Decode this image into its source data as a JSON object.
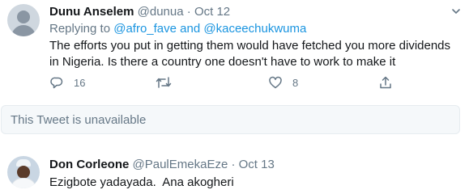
{
  "tweet1": {
    "name": "Dunu Anselem",
    "handle": "@dunua",
    "separator": "·",
    "date": "Oct 12",
    "replying_prefix": "Replying to",
    "reply_handle_1": "@afro_fave",
    "reply_and": "and",
    "reply_handle_2": "@kaceechukwuma",
    "text": "The efforts you put in getting them would have fetched you more dividends in Nigeria. Is there a country one doesn't have to work to make it",
    "reply_count": "16",
    "like_count": "8"
  },
  "unavailable": {
    "text": "This Tweet is unavailable"
  },
  "tweet2": {
    "name": "Don Corleone",
    "handle": "@PaulEmekaEze",
    "separator": "·",
    "date": "Oct 13",
    "text": "Ezigbote yadayada.  Ana akogheri"
  },
  "colors": {
    "link": "#1b95e0",
    "meta": "#657786",
    "text": "#14171a",
    "unavailable_bg": "#f5f8fa",
    "border": "#e6ecf0"
  },
  "icons": [
    "reply-icon",
    "retweet-icon",
    "like-icon",
    "share-icon",
    "caret-down-icon"
  ]
}
